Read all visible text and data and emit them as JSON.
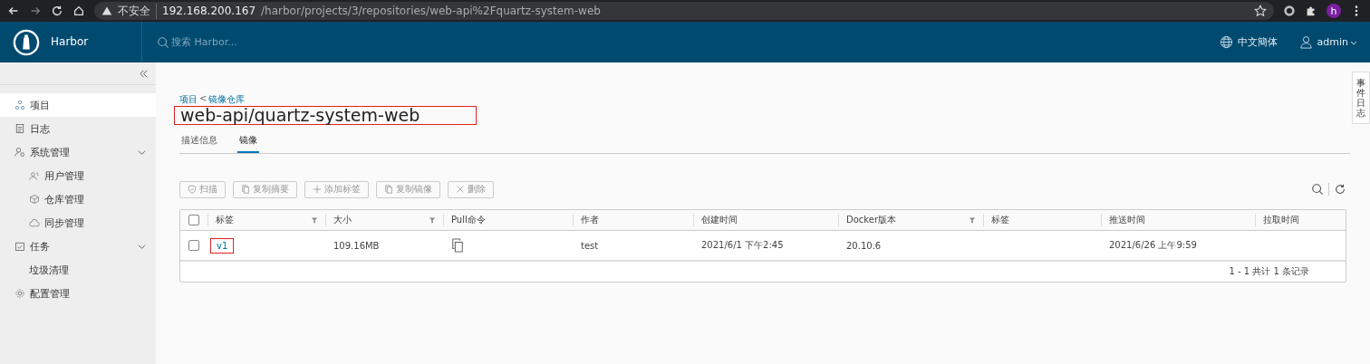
{
  "browser": {
    "security": "不安全",
    "url_host": "192.168.200.167",
    "url_path": "/harbor/projects/3/repositories/web-api%2Fquartz-system-web",
    "avatar": "h"
  },
  "header": {
    "brand": "Harbor",
    "search_placeholder": "搜索 Harbor...",
    "language": "中文簡体",
    "user": "admin"
  },
  "sidebar": {
    "items": [
      {
        "label": "项目",
        "selected": true
      },
      {
        "label": "日志",
        "selected": false
      },
      {
        "label": "系统管理",
        "selected": false,
        "expanded": true,
        "children": [
          {
            "label": "用户管理",
            "selected": false
          },
          {
            "label": "仓库管理",
            "selected": false
          },
          {
            "label": "同步管理",
            "selected": false
          }
        ]
      },
      {
        "label": "任务",
        "selected": false,
        "expanded": true,
        "children": [
          {
            "label": "垃圾清理",
            "selected": false
          }
        ]
      },
      {
        "label": "配置管理",
        "selected": false
      }
    ]
  },
  "side_tab": "事件日志",
  "breadcrumb": {
    "items": [
      "项目",
      "镜像仓库"
    ],
    "separator": "<"
  },
  "title": {
    "text": "web-api/quartz-system-web",
    "highlighted": true
  },
  "tabs": [
    {
      "label": "描述信息",
      "selected": false
    },
    {
      "label": "镜像",
      "selected": true
    }
  ],
  "toolbar": [
    {
      "label": "扫描",
      "disabled": true
    },
    {
      "label": "复制摘要",
      "disabled": true
    },
    {
      "label": "添加标签",
      "disabled": true
    },
    {
      "label": "复制镜像",
      "disabled": true
    },
    {
      "label": "删除",
      "disabled": true
    }
  ],
  "table": {
    "all_checked": false,
    "columns": [
      {
        "label": "标签",
        "filter": true
      },
      {
        "label": "大小",
        "filter": true
      },
      {
        "label": "Pull命令",
        "filter": false
      },
      {
        "label": "作者",
        "filter": false
      },
      {
        "label": "创建时间",
        "filter": false
      },
      {
        "label": "Docker版本",
        "filter": true
      },
      {
        "label": "标签",
        "filter": false
      },
      {
        "label": "推送时间",
        "filter": false
      },
      {
        "label": "拉取时间",
        "filter": false
      }
    ],
    "rows": [
      {
        "checked": false,
        "cells": [
          {
            "kind": "link",
            "text": "v1",
            "highlighted": true
          },
          {
            "kind": "text",
            "text": "109.16MB"
          },
          {
            "kind": "copy"
          },
          {
            "kind": "text",
            "text": "test"
          },
          {
            "kind": "text",
            "text": "2021/6/1 下午2:45"
          },
          {
            "kind": "text",
            "text": "20.10.6"
          },
          {
            "kind": "empty"
          },
          {
            "kind": "text",
            "text": "2021/6/26 上午9:59"
          },
          {
            "kind": "empty"
          }
        ]
      }
    ],
    "footer": "1 - 1 共计 1 条记录"
  }
}
